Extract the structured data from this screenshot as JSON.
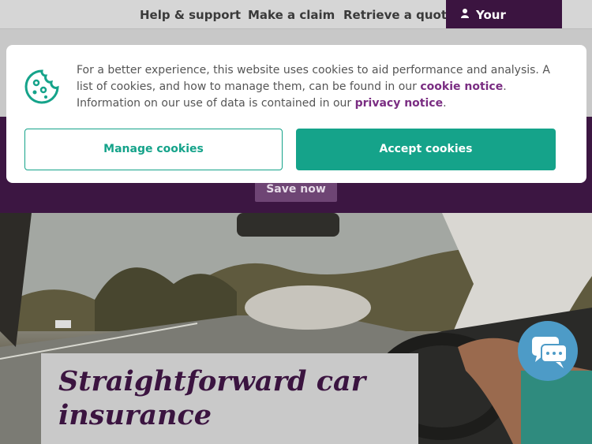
{
  "nav": {
    "help_label": "Help & support",
    "claim_label": "Make a claim",
    "retrieve_label": "Retrieve a quote",
    "account_label": "Your Account"
  },
  "promo": {
    "save_label": "Save now"
  },
  "hero": {
    "title": "Straightforward car insurance"
  },
  "cookie_banner": {
    "text_1": "For a better experience, this website uses cookies to aid performance and analysis. A list of cookies, and how to manage them, can be found in our ",
    "cookie_notice_link": "cookie notice",
    "text_2": ". Information on our use of data is contained in our ",
    "privacy_notice_link": "privacy notice",
    "text_3": ".",
    "manage_label": "Manage cookies",
    "accept_label": "Accept cookies"
  },
  "colors": {
    "brand_purple": "#3b1440",
    "accent_teal": "#15a38a",
    "link_purple": "#7a2d82",
    "chat_blue": "#4d9bc7"
  }
}
